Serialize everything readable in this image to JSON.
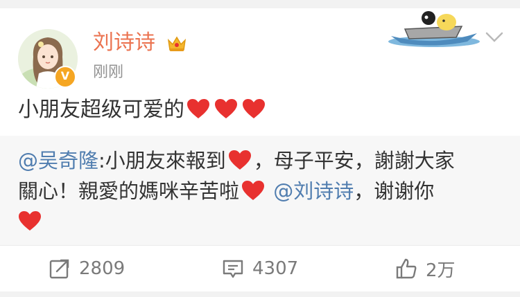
{
  "post": {
    "author": "刘诗诗",
    "time": "刚刚",
    "text": "小朋友超级可爱的",
    "text_hearts": 3
  },
  "repost": {
    "mention1": "@吴奇隆",
    "part1": ":小朋友來報到",
    "part2": "，母子平安，謝謝大家",
    "part3": "關心！親愛的媽咪辛苦啦",
    "mention2": "@刘诗诗",
    "part4": "，谢谢你"
  },
  "actions": {
    "repost_count": "2809",
    "comment_count": "4307",
    "like_count": "2万"
  },
  "colors": {
    "username": "#eb7350",
    "mention": "#507daf",
    "heart": "#e8312f",
    "repost_bg": "#f7f7f7"
  },
  "icons": [
    "crown-icon",
    "verified-badge-icon",
    "boat-sticker-icon",
    "chevron-down-icon",
    "heart-icon",
    "repost-icon",
    "comment-icon",
    "like-icon"
  ]
}
